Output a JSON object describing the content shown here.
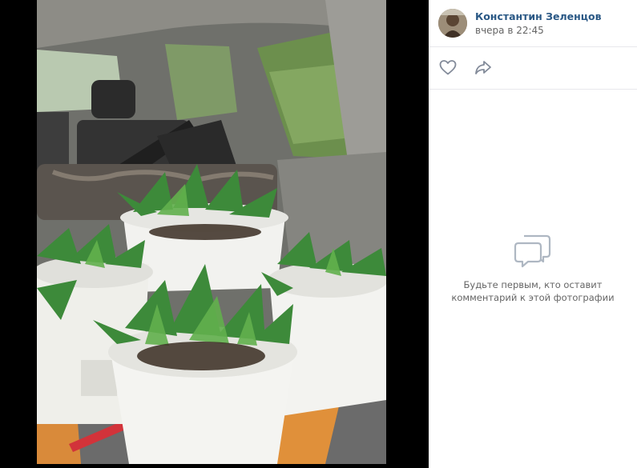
{
  "post": {
    "author_name": "Константин Зеленцов",
    "timestamp": "вчера в 22:45"
  },
  "actions": {
    "like_icon": "heart-icon",
    "share_icon": "share-arrow-icon"
  },
  "comments": {
    "empty_icon": "speech-bubbles-icon",
    "empty_text": "Будьте первым, кто оставит комментарий к этой фотографии"
  },
  "colors": {
    "author_link": "#2a5885",
    "secondary_text": "#656565",
    "icon_gray": "#828a99",
    "divider": "#e7e8ec"
  }
}
